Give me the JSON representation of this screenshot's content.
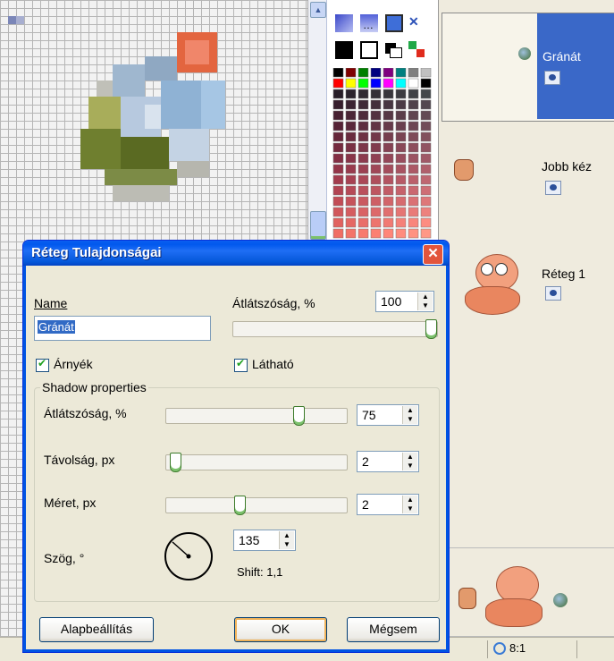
{
  "layers": [
    {
      "name": "Gránát",
      "selected": true
    },
    {
      "name": "Jobb kéz",
      "selected": false
    },
    {
      "name": "Réteg 1",
      "selected": false
    }
  ],
  "status": {
    "zoom": "8:1"
  },
  "dialog": {
    "title": "Réteg Tulajdonságai",
    "name_label": "Name",
    "name_value": "Gránát",
    "opacity_label": "Átlátszóság, %",
    "opacity_value": "100",
    "opacity_level": 1.0,
    "shadow_checkbox": "Árnyék",
    "visible_checkbox": "Látható",
    "shadow_group": "Shadow properties",
    "shadow_opacity_label": "Átlátszóság, %",
    "shadow_opacity_value": "75",
    "shadow_opacity_level": 0.75,
    "distance_label": "Távolság, px",
    "distance_value": "2",
    "distance_level": 0.02,
    "size_label": "Méret, px",
    "size_value": "2",
    "size_level": 0.4,
    "angle_label": "Szög, °",
    "angle_value": "135",
    "shift_text": "Shift: 1,1",
    "btn_default": "Alapbeállítás",
    "btn_ok": "OK",
    "btn_cancel": "Mégsem"
  },
  "colors": {
    "title_blue": "#0058ee",
    "selection_blue": "#3a68c8",
    "close_red": "#e2553c"
  }
}
